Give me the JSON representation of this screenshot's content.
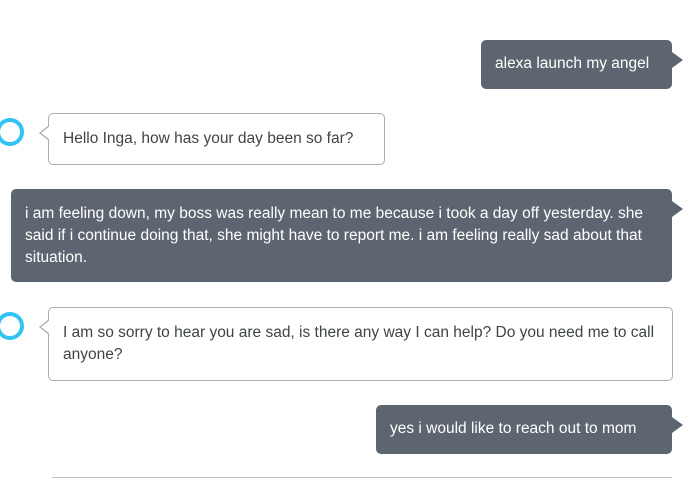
{
  "conversation": {
    "messages": [
      {
        "speaker": "user",
        "text": "alexa launch my angel"
      },
      {
        "speaker": "alexa",
        "text": "Hello Inga, how has your day been so far?"
      },
      {
        "speaker": "user",
        "text": "i am feeling down, my boss was really mean to me because i took a day off yesterday. she said if i continue doing that, she might have to report me. i am feeling really sad about that situation."
      },
      {
        "speaker": "alexa",
        "text": "I am so sorry to hear you are sad, is there any way I can help? Do you need me to call anyone?"
      },
      {
        "speaker": "user",
        "text": "yes i would like to reach out to mom"
      }
    ]
  },
  "colors": {
    "user_bubble": "#5d6670",
    "alexa_border": "#a7b0b7",
    "alexa_ring": "#31c4f3"
  },
  "icons": {
    "alexa_avatar": "alexa-ring-icon"
  }
}
